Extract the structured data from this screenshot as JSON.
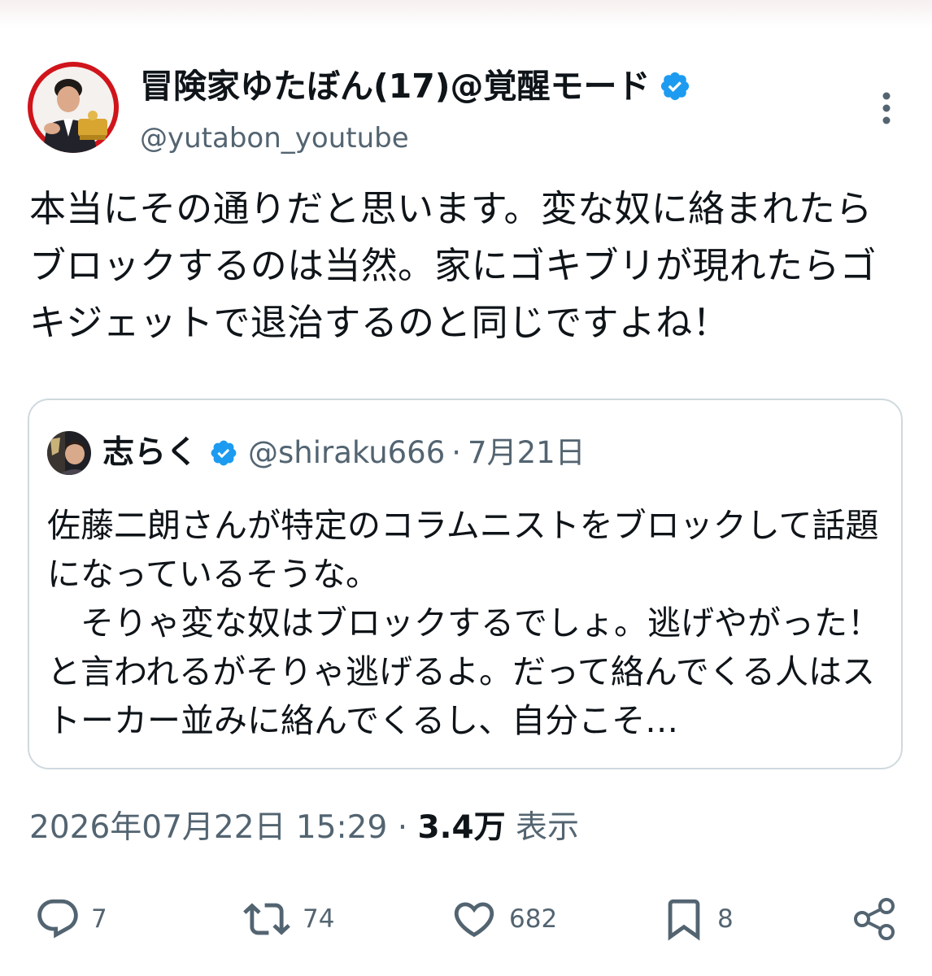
{
  "author": {
    "name": "冒険家ゆたぼん(17)@覚醒モード",
    "handle": "@yutabon_youtube",
    "verified": true
  },
  "tweet": {
    "text": "本当にその通りだと思います。変な奴に絡まれたらブロックするのは当然。家にゴキブリが現れたらゴキジェットで退治するのと同じですよね！"
  },
  "quoted": {
    "name": "志らく",
    "handle": "@shiraku666",
    "separator": "·",
    "date": "7月21日",
    "text": "佐藤二朗さんが特定のコラムニストをブロックして話題になっているそうな。\n　そりゃ変な奴はブロックするでしょ。逃げやがった！と言われるがそりゃ逃げるよ。だって絡んでくる人はストーカー並みに絡んでくるし、自分こそ…"
  },
  "meta": {
    "timestamp": "2026年07月22日 15:29",
    "separator": " · ",
    "views": "3.4万",
    "views_label": " 表示"
  },
  "actions": {
    "reply_count": "7",
    "repost_count": "74",
    "like_count": "682",
    "bookmark_count": "8"
  },
  "colors": {
    "verified_blue": "#1d9bf0",
    "secondary_text": "#536471",
    "border": "#cfd9de",
    "avatar_background": "#d0141b"
  }
}
